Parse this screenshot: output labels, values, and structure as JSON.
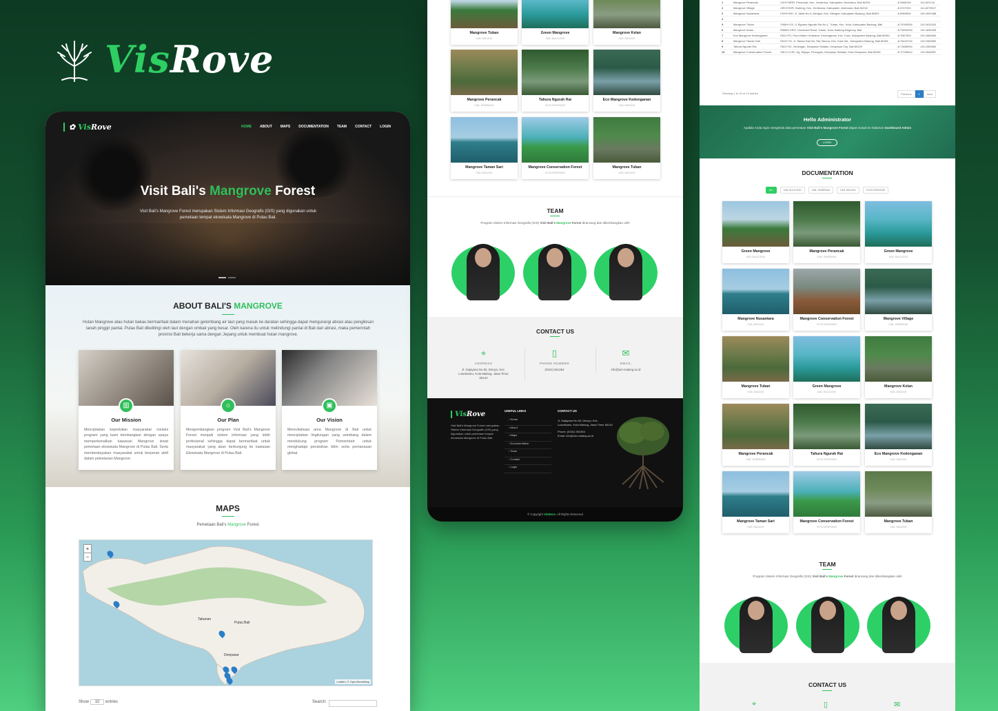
{
  "brand": {
    "vis": "Vis",
    "rove": "Rove"
  },
  "site": {
    "nav": [
      "HOME",
      "ABOUT",
      "MAPS",
      "DOCUMENTATION",
      "TEAM",
      "CONTACT",
      "LOGIN"
    ],
    "hero": {
      "title_a": "Visit Bali's",
      "title_b": "Mangrove",
      "title_c": "Forest",
      "text": "Visit Bali's Mangrove Forest merupakan Sistem Informasi Geografis (GIS) yang digunakan untuk pemetaan tempat ekowisata Mangrove di Pulau Bali."
    },
    "about": {
      "title_a": "ABOUT BALI'S",
      "title_b": "MANGROVE",
      "text": "Hutan Mangrove atau hutan bakau bermanfaat dalam menahan gelombang air laut yang masuk ke daratan sehingga dapat mengurangi abrasi atau pengikisan tanah pinggir pantai. Pulau Bali dikelilingi oleh laut dengan ombak yang besar. Oleh karena itu untuk melindungi pantai di Bali dari abrasi, maka pemerintah provinsi Bali bekerja sama dengan Jepang untuk membuat hutan mangrove.",
      "cards": [
        {
          "title": "Our Mission",
          "icon": "chart-icon",
          "text": "Menciptakan kepedulian masyarakat melalui program yang kami kembangkan dengan upaya memperkenalkan kawasan Mangrove lewat pemetaan ekowisata Mangrove di Pulau Bali. Serta memberdayakan masyarakat untuk berperan aktif dalam pelestarian Mangrove."
        },
        {
          "title": "Our Plan",
          "icon": "sun-icon",
          "text": "Mengembangkan program Visit Bali's Mangrove Forest menjadi sistem informasi yang lebih profesional sehingga dapat bermanfaat untuk masyarakat yang akan berkunjung ke kawasan Ekowisata Mangrove di Pulau Bali."
        },
        {
          "title": "Our Vision",
          "icon": "image-icon",
          "text": "Merevitalisasi area Mangrove di Bali untuk menciptakan lingkungan yang seimbang dalam mendukung program Pemerintah untuk menghadapi perubahan iklim serta pemanasan global."
        }
      ]
    },
    "maps": {
      "title": "MAPS",
      "sub_a": "Pemetaan Bali's",
      "sub_b": "Mangrove",
      "sub_c": "Forest",
      "zoom_in": "+",
      "zoom_out": "−",
      "attribution": "Leaflet | © OpenStreetMap",
      "label_island": "Pulau Bali",
      "label_tabanan": "Tabanan",
      "label_denpasar": "Denpasar",
      "show": "Show",
      "show_val": "10",
      "entries": "entries",
      "search": "Search:"
    }
  },
  "gallery_top": [
    {
      "name": "Mangrove Tuban",
      "loc": "KAB. BADUNG"
    },
    {
      "name": "Green Mangrove",
      "loc": "KAB. BULELENG"
    },
    {
      "name": "Mangrove Kelan",
      "loc": "KAB. BADUNG"
    },
    {
      "name": "Mangrove Perancak",
      "loc": "KAB. JEMBRANA"
    },
    {
      "name": "Tahura Ngurah Rai",
      "loc": "KOTA DENPASAR"
    },
    {
      "name": "Eco Mangrove Kedonganan",
      "loc": "KAB. BADUNG"
    },
    {
      "name": "Mangrove Taman Sari",
      "loc": "KAB. BADUNG"
    },
    {
      "name": "Mangrove Conservation Forest",
      "loc": "KOTA DENPASAR"
    },
    {
      "name": "Mangrove Tuban",
      "loc": "KAB. BADUNG"
    }
  ],
  "team": {
    "title": "TEAM",
    "text_a": "Program Sistem Informasi Geografis (GIS)",
    "text_b": "Visit Bali's",
    "text_c": "Mangrove",
    "text_d": "Forest",
    "text_e": "dirancang dan dikembangkan oleh"
  },
  "contact": {
    "title": "CONTACT US",
    "address_h": "ADDRESS",
    "address": "Jl. Gajayana No.50, Dinoyo, Kec. Lowokwaru, Kota Malang, Jawa Timur 65144",
    "phone_h": "PHONE NUMBER",
    "phone": "(0341) 551354",
    "email_h": "EMAIL",
    "email": "info@uin-malang.ac.id"
  },
  "footer": {
    "logo_a": "Vis",
    "logo_b": "Rove",
    "desc": "Visit Bali's Mangrove Forest merupakan Sistem Informasi Geografis (GIS) yang digunakan untuk pemetaan tempat ekowisata Mangrove di Pulau Bali.",
    "links_h": "USEFUL LINKS",
    "links": [
      "Home",
      "About",
      "Maps",
      "Documentation",
      "Team",
      "Contact",
      "Login"
    ],
    "contact_h": "CONTACT US",
    "addr": "Jl. Gajayana No.50, Dinoyo, Kec. Lowokwaru, Kota Malang, Jawa Timur 65144",
    "phone": "Phone: (0341) 551354",
    "email": "Email: info@uin-malang.ac.id",
    "copy_a": "© Copyright",
    "copy_b": "VisRove",
    "copy_c": ". All Rights Reserved"
  },
  "table": {
    "rows": [
      [
        "1",
        "Mangrove Perancak",
        "JJCH+MRR, Perancak, Kec. Jembrana, Kabupaten Jembrana, Bali 82251",
        "-8.3986194",
        "114.622144"
      ],
      [
        "2",
        "Mangrove Village",
        "J4RJ+HHR, Budeng, Kec. Jembrana, Kabupaten Jembrana, Bali 82218",
        "-8.3747024",
        "114.6278917"
      ],
      [
        "3",
        "Mangrove Nusantara",
        "C5X9+WH, Jl. Jalak No.3, Mengwi, Kec. Mengwi, Kabupaten Badung, Bali 80351",
        "-8.5069534",
        "115.1691968"
      ],
      [
        "4",
        "",
        "",
        "",
        ""
      ],
      [
        "5",
        "Mangrove Tuban",
        "7HMH+C8, Jl. Bypass Ngurah Rai No.1, Tuban, Kec. Kuta, Kabupaten Badung, Bali",
        "-8.74395354",
        "115.1631163"
      ],
      [
        "6",
        "Mangrove Kelan",
        "G5MM+XRG, Unnamed Road, Tuban, Kuta, Badung Regency, Bali",
        "-8.75250334",
        "115.1835335"
      ],
      [
        "7",
        "Eco Mangrove Kedonganan",
        "G5JJ+F2, Pura Dalem Jimbaran, Kedonganan, Kec. Kuta, Kabupaten Badung, Bali 80361",
        "-8.7667903",
        "115.1860964"
      ],
      [
        "8",
        "Mangrove Taman Sari",
        "G5JV+76, Jl. Taman Sari No.78a, Benoa, Kec. Kuta Sel., Kabupaten Badung, Bali 80361",
        "-8.78102744",
        "115.1983982"
      ],
      [
        "9",
        "Tahura Ngurah Rai",
        "7MJJ+9C, Serangan, Denpasar Selatan, Denpasar City, Bali 80229",
        "-8.73489944",
        "115.2305962"
      ],
      [
        "10",
        "Mangrove Conservation Forest",
        "7MCV+XJR, Gg. Wijaya, Pemogan, Denpasar Selatan, Kota Denpasar, Bali 80361",
        "-8.72789614",
        "115.2946597"
      ]
    ],
    "info": "Showing 1 to 10 of 13 entries",
    "prev": "Previous",
    "page": "1",
    "next": "Next"
  },
  "admin": {
    "title": "Hello Administrator",
    "text_a": "Apabila Anda ingin mengelola data pemetaan",
    "text_b": "Visit Bali's Mangrove Forest",
    "text_c": "dapat masuk ke halaman",
    "text_d": "Dashboard Admin",
    "btn": "LOGIN"
  },
  "documentation": {
    "title": "DOCUMENTATION",
    "filters": [
      "ALL",
      "KAB. BULELENG",
      "KAB. JEMBRANA",
      "KAB. BADUNG",
      "KOTA DENPASAR"
    ],
    "items": [
      {
        "name": "Green Mangrove",
        "loc": "KAB. BULELENG"
      },
      {
        "name": "Mangrove Perancak",
        "loc": "KAB. JEMBRANA"
      },
      {
        "name": "Green Mangrove",
        "loc": "KAB. BULELENG"
      },
      {
        "name": "Mangrove Nusantara",
        "loc": "KAB. BADUNG"
      },
      {
        "name": "Mangrove Conservation Forest",
        "loc": "KOTA DENPASAR"
      },
      {
        "name": "Mangrove Village",
        "loc": "KAB. JEMBRANA"
      },
      {
        "name": "Mangrove Tuban",
        "loc": "KAB. BADUNG"
      },
      {
        "name": "Green Mangrove",
        "loc": "KAB. BULELENG"
      },
      {
        "name": "Mangrove Kelan",
        "loc": "KAB. BADUNG"
      },
      {
        "name": "Mangrove Perancak",
        "loc": "KAB. JEMBRANA"
      },
      {
        "name": "Tahura Ngurah Rai",
        "loc": "KOTA DENPASAR"
      },
      {
        "name": "Eco Mangrove Kedonganan",
        "loc": "KAB. BADUNG"
      },
      {
        "name": "Mangrove Taman Sari",
        "loc": "KAB. BADUNG"
      },
      {
        "name": "Mangrove Conservation Forest",
        "loc": "KOTA DENPASAR"
      },
      {
        "name": "Mangrove Tuban",
        "loc": "KAB. BADUNG"
      }
    ]
  },
  "contact2": {
    "title": "CONTACT US"
  },
  "colors": {
    "accent": "#2fce63",
    "dark": "#111111",
    "link": "#2a7ec6"
  }
}
